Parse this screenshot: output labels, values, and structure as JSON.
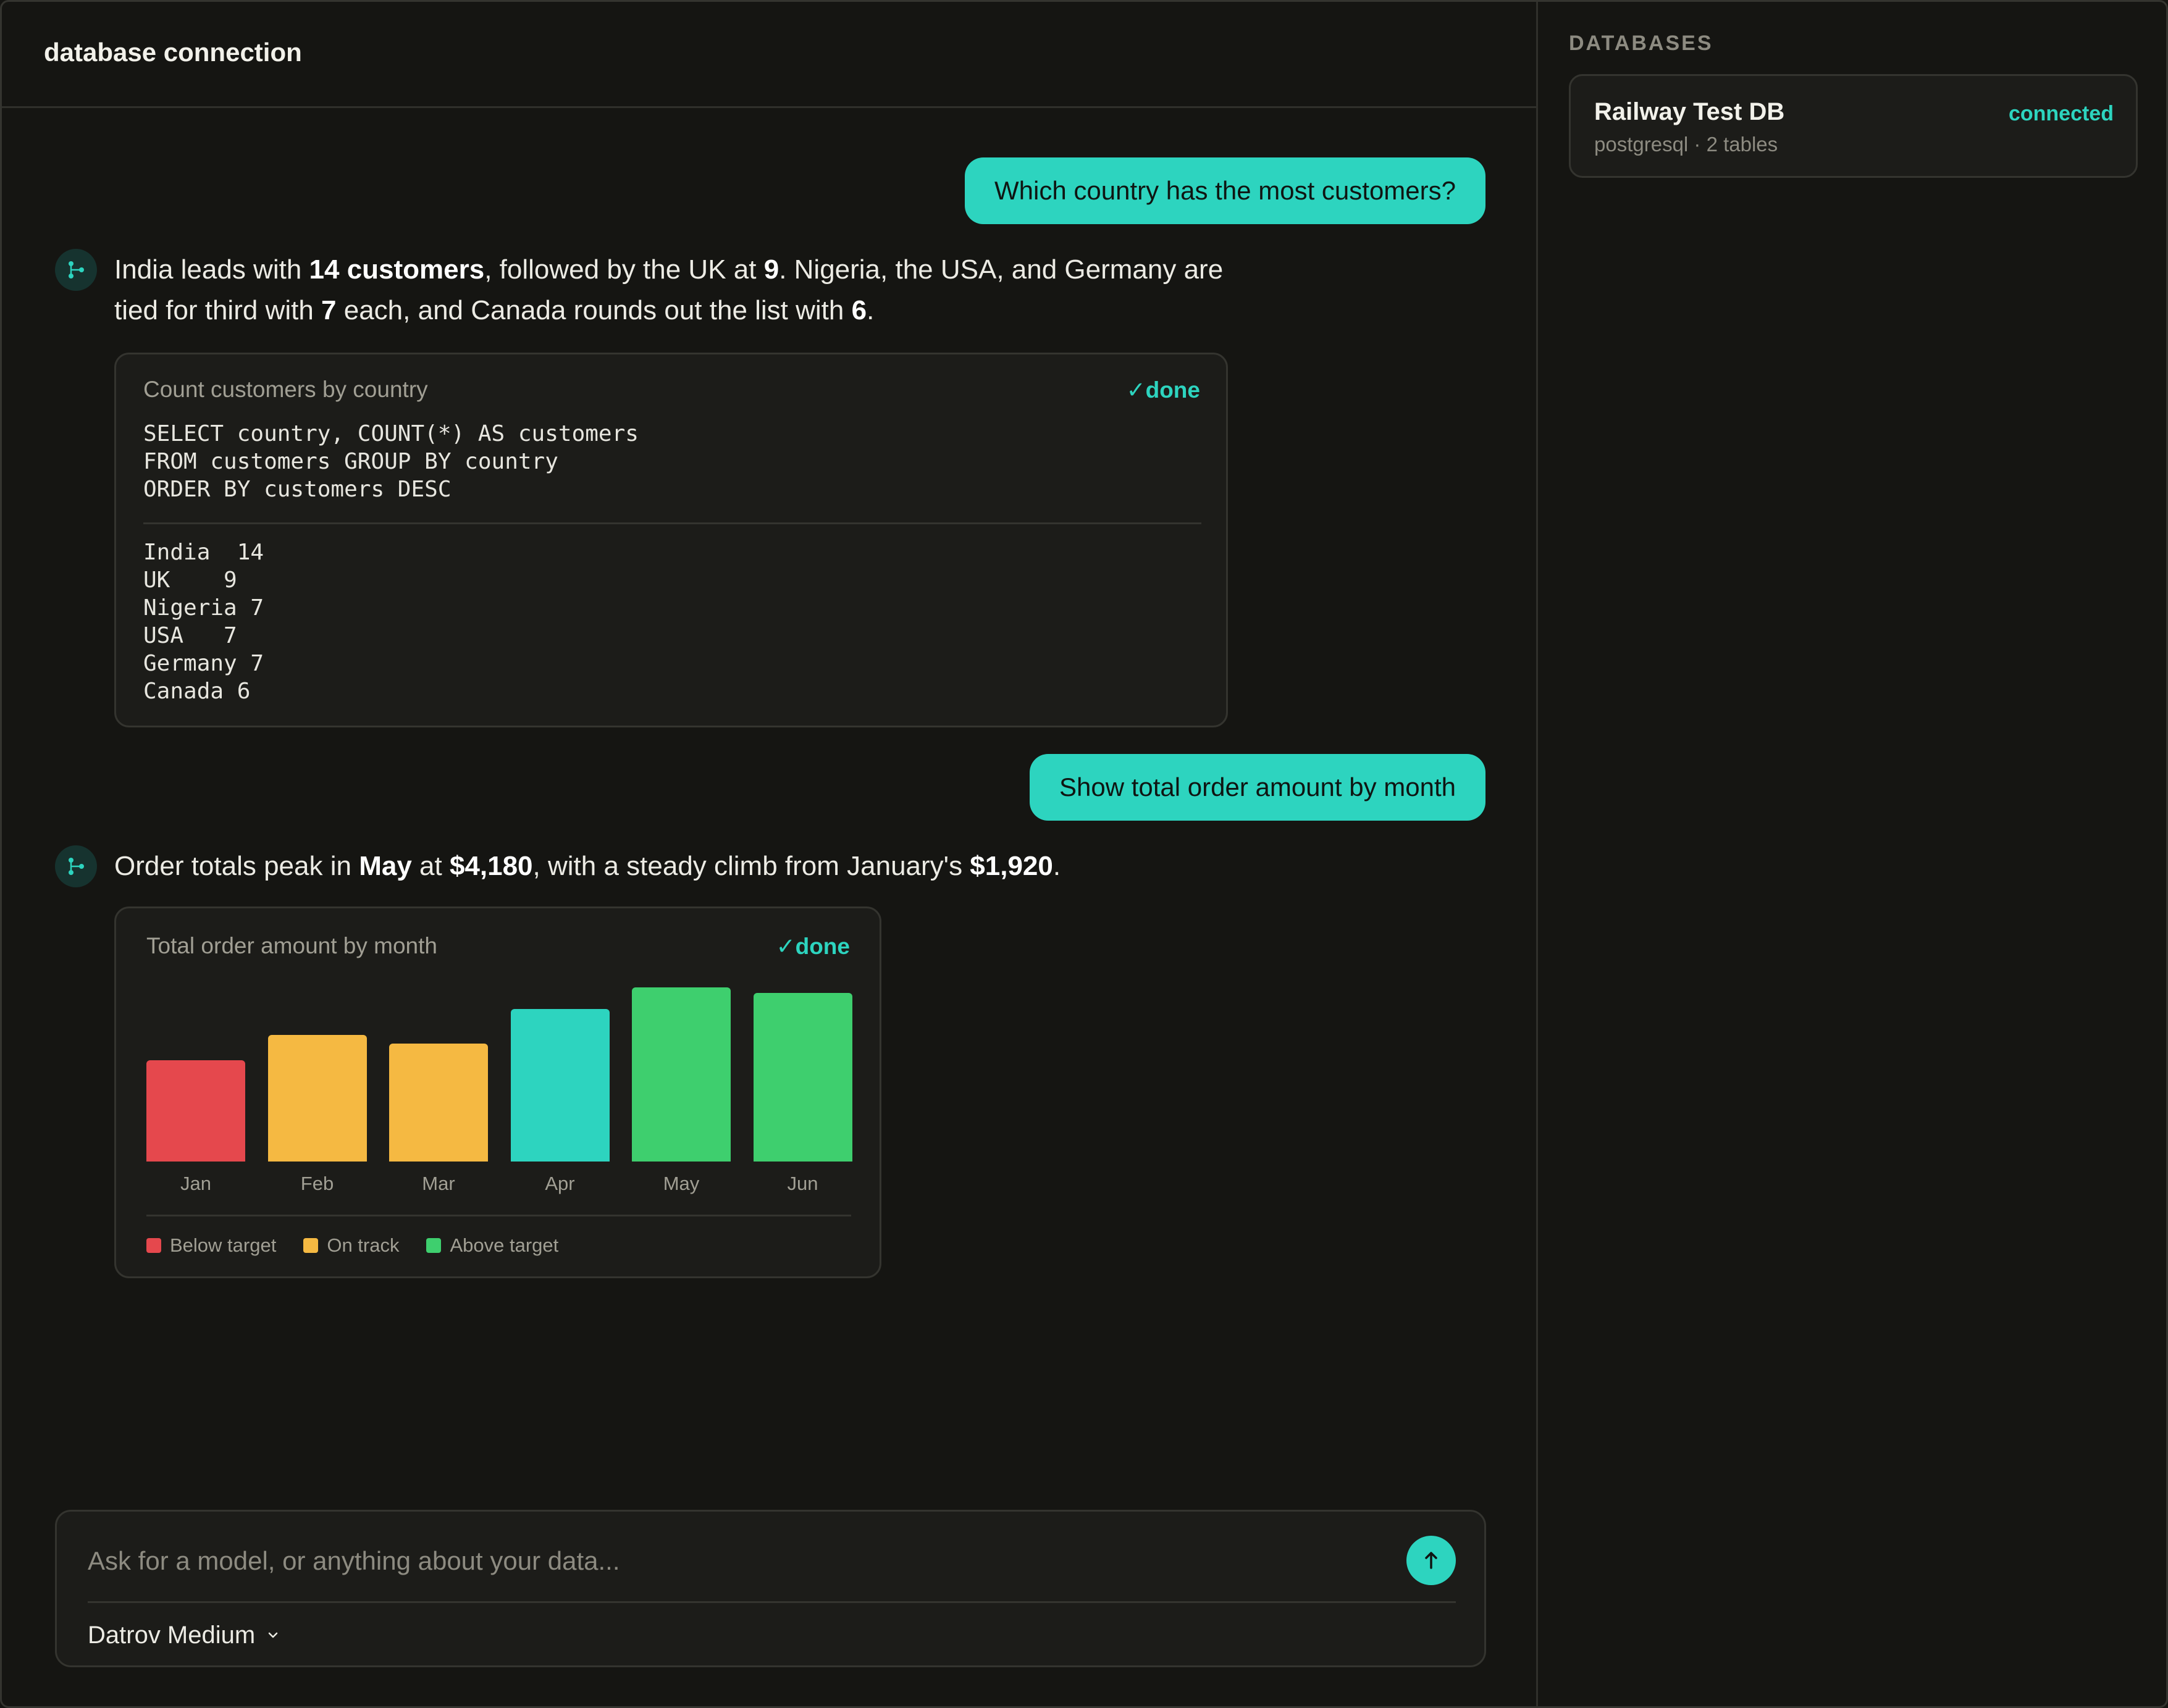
{
  "header": {
    "title": "database connection"
  },
  "conversation": {
    "user_message_1": "Which country has the most customers?",
    "assistant_1": {
      "t1": "India leads with ",
      "b1": "14 customers",
      "t2": ", followed by the UK at ",
      "b2": "9",
      "t3": ". Nigeria, the USA, and Germany are tied for third with ",
      "b3": "7",
      "t4": " each, and Canada rounds out the list with ",
      "b4": "6",
      "t5": "."
    },
    "query_card": {
      "title": "Count customers by country",
      "status": "done",
      "sql": "SELECT country, COUNT(*) AS customers\nFROM customers GROUP BY country\nORDER BY customers DESC",
      "result": "India  14\nUK    9\nNigeria 7\nUSA   7\nGermany 7\nCanada 6"
    },
    "user_message_2": "Show total order amount by month",
    "assistant_2": {
      "t1": "Order totals peak in ",
      "b1": "May",
      "t2": " at ",
      "b2": "$4,180",
      "t3": ", with a steady climb from January's ",
      "b3": "$1,920",
      "t4": "."
    },
    "chart_card": {
      "title": "Total order amount by month",
      "status": "done"
    }
  },
  "chart_data": {
    "type": "bar",
    "title": "Total order amount by month",
    "categories": [
      "Jan",
      "Feb",
      "Mar",
      "Apr",
      "May",
      "Jun"
    ],
    "values": [
      1920,
      2400,
      2230,
      2890,
      4180,
      3190
    ],
    "y_scale_max": 3300,
    "statuses": [
      "below",
      "on_track",
      "on_track",
      "cyan",
      "above",
      "above"
    ],
    "legend": [
      {
        "key": "below",
        "label": "Below target",
        "color": "#e5484d"
      },
      {
        "key": "on_track",
        "label": "On track",
        "color": "#f5b942"
      },
      {
        "key": "above",
        "label": "Above target",
        "color": "#3ecf6e"
      }
    ],
    "colors": {
      "below": "#e5484d",
      "on_track": "#f5b942",
      "above": "#3ecf6e",
      "cyan": "#2dd4bf"
    },
    "legend_placement": "bottom-left",
    "grid": false
  },
  "composer": {
    "placeholder": "Ask for a model, or anything about your data...",
    "model": "Datrov Medium"
  },
  "sidebar": {
    "heading": "DATABASES",
    "databases": [
      {
        "name": "Railway Test DB",
        "meta": "postgresql · 2 tables",
        "status": "connected"
      }
    ]
  },
  "theme": {
    "accent": "#2dd4bf",
    "background": "#151512",
    "card": "#1c1c19"
  }
}
